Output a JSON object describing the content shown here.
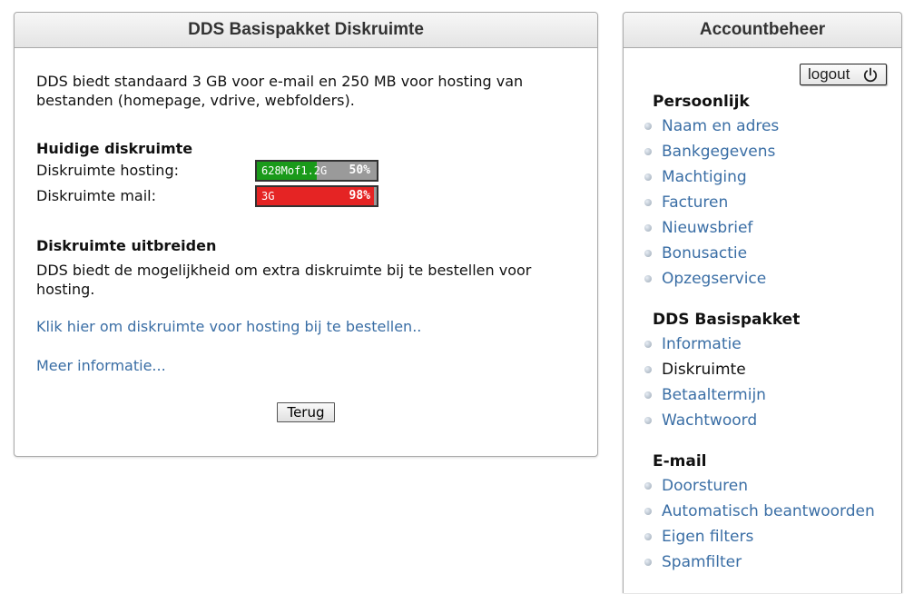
{
  "main": {
    "title": "DDS Basispakket Diskruimte",
    "intro": "DDS biedt standaard 3 GB voor e-mail en 250 MB voor hosting van bestanden (homepage, vdrive, webfolders).",
    "current_title": "Huidige diskruimte",
    "hosting": {
      "label": "Diskruimte hosting:",
      "bar_text": "628Mof1.2G",
      "percent_label": "50%",
      "fraction": 0.5,
      "color": "#1a9a1a"
    },
    "mail": {
      "label": "Diskruimte mail:",
      "bar_text": "3G",
      "percent_label": "98%",
      "fraction": 0.98,
      "color": "#e52424"
    },
    "extend_title": "Diskruimte uitbreiden",
    "extend_text": "DDS biedt de mogelijkheid om extra diskruimte bij te bestellen voor hosting.",
    "order_link": "Klik hier om diskruimte voor hosting bij te bestellen..",
    "more_link": "Meer informatie...",
    "back_button": "Terug"
  },
  "sidebar": {
    "title": "Accountbeheer",
    "logout_label": "logout",
    "logout_icon": "power-icon",
    "sections": [
      {
        "title": "Persoonlijk",
        "items": [
          "Naam en adres",
          "Bankgegevens",
          "Machtiging",
          "Facturen",
          "Nieuwsbrief",
          "Bonusactie",
          "Opzegservice"
        ]
      },
      {
        "title": "DDS Basispakket",
        "items": [
          "Informatie",
          "Diskruimte",
          "Betaaltermijn",
          "Wachtwoord"
        ]
      },
      {
        "title": "E-mail",
        "items": [
          "Doorsturen",
          "Automatisch beantwoorden",
          "Eigen filters",
          "Spamfilter"
        ]
      }
    ],
    "current_item": "Diskruimte"
  },
  "colors": {
    "link": "#3a6ea5",
    "bar_background": "#9a9a9a"
  }
}
